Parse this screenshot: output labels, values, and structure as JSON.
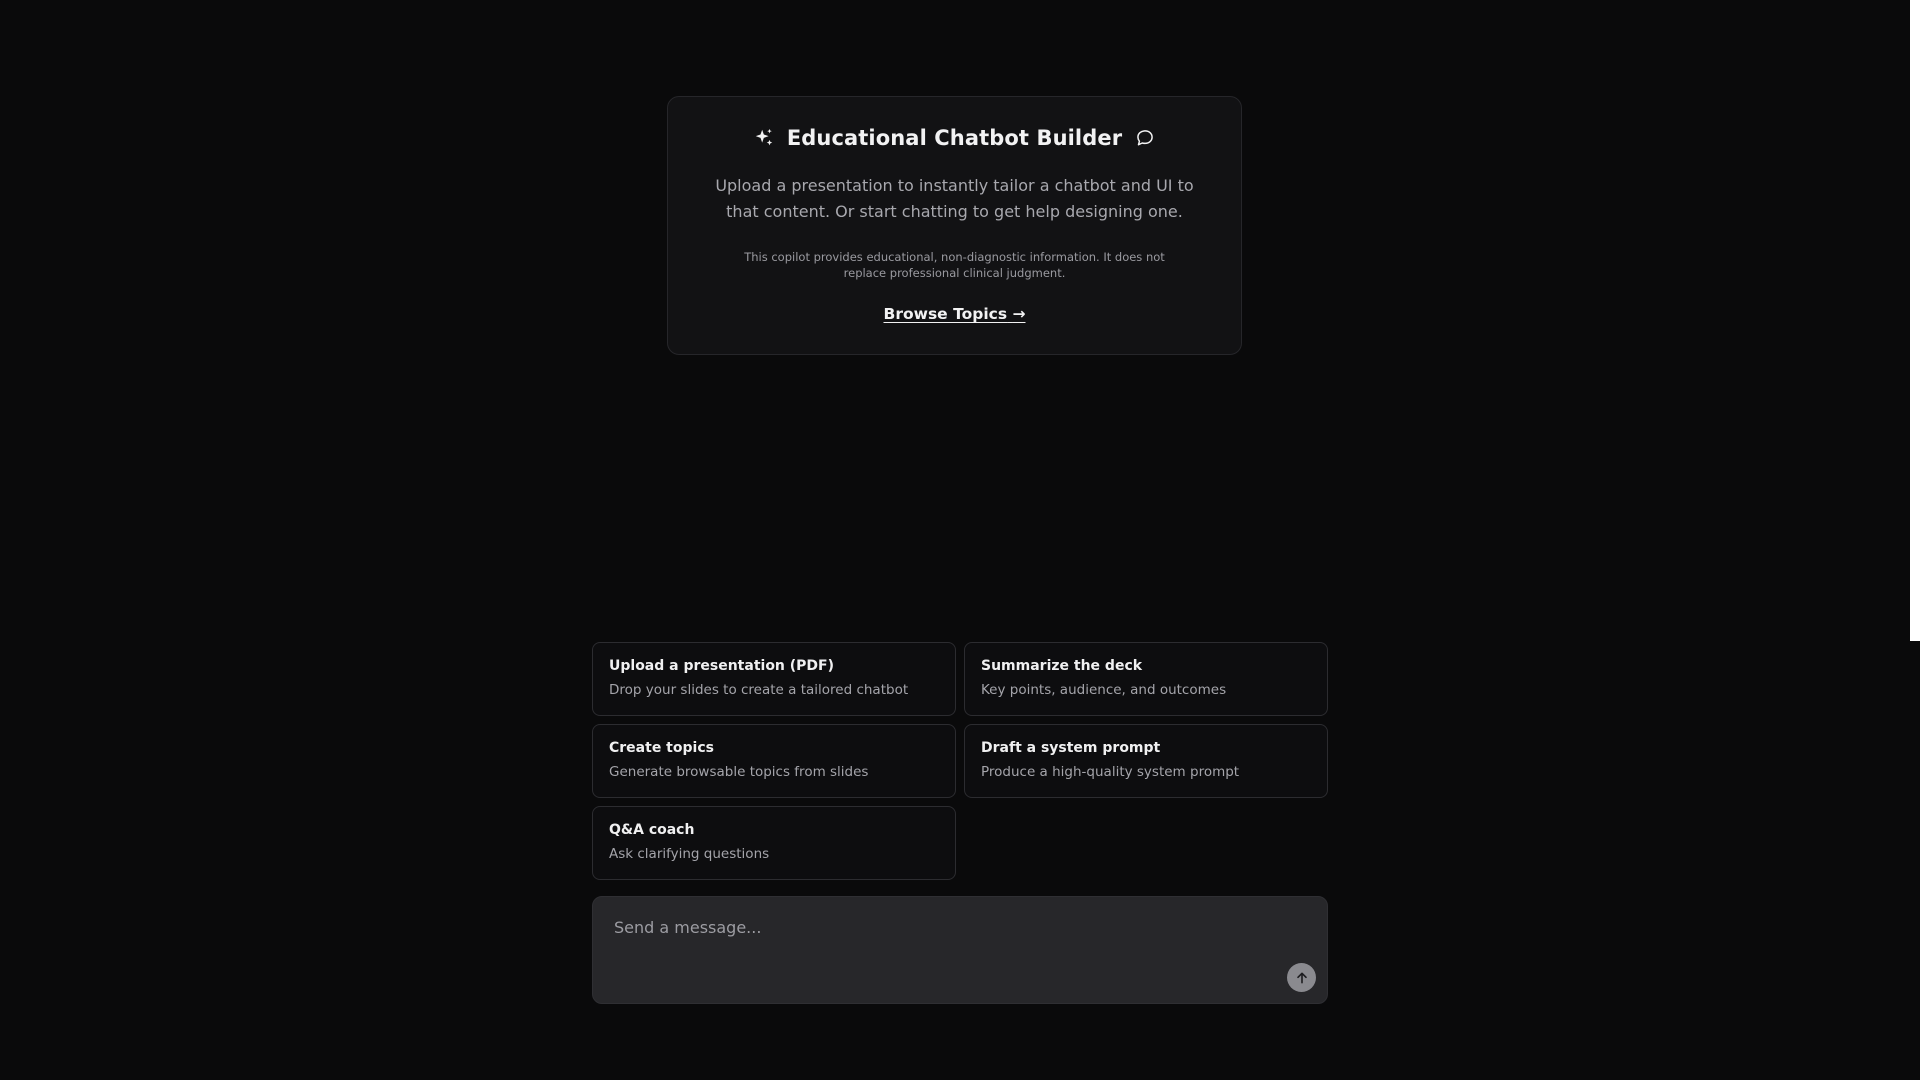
{
  "intro": {
    "title": "Educational Chatbot Builder",
    "title_icon_left": "sparkles-icon",
    "title_icon_right": "chat-bubble-icon",
    "description": "Upload a presentation to instantly tailor a chatbot and UI to that content. Or start chatting to get help designing one.",
    "disclaimer": "This copilot provides educational, non-diagnostic information. It does not replace professional clinical judgment.",
    "browse_link": "Browse Topics",
    "browse_arrow": "→"
  },
  "suggestions": [
    {
      "title": "Upload a presentation (PDF)",
      "subtitle": "Drop your slides to create a tailored chatbot"
    },
    {
      "title": "Summarize the deck",
      "subtitle": "Key points, audience, and outcomes"
    },
    {
      "title": "Create topics",
      "subtitle": "Generate browsable topics from slides"
    },
    {
      "title": "Draft a system prompt",
      "subtitle": "Produce a high-quality system prompt"
    },
    {
      "title": "Q&A coach",
      "subtitle": "Ask clarifying questions"
    }
  ],
  "composer": {
    "placeholder": "Send a message...",
    "value": "",
    "send_icon": "arrow-up-icon"
  },
  "colors": {
    "background": "#0a0a0b",
    "card_background": "#121214",
    "composer_background": "#27272a",
    "send_button": "#8a8a8f"
  }
}
